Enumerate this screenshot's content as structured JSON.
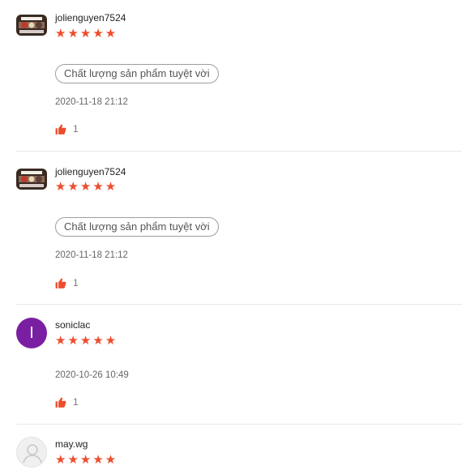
{
  "reviews": [
    {
      "username": "jolienguyen7524",
      "stars": "★★★★★",
      "tag": "Chất lượng sản phẩm tuyệt vời",
      "date": "2020-11-18 21:12",
      "likes": "1",
      "avatar": "product-photo"
    },
    {
      "username": "jolienguyen7524",
      "stars": "★★★★★",
      "tag": "Chất lượng sản phẩm tuyệt vời",
      "date": "2020-11-18 21:12",
      "likes": "1",
      "avatar": "product-photo"
    },
    {
      "username": "soniclac",
      "stars": "★★★★★",
      "avatar_letter": "I",
      "date": "2020-10-26 10:49",
      "likes": "1"
    },
    {
      "username": "may.wg",
      "stars": "★★★★★",
      "avatar": "default-user-icon"
    }
  ],
  "colors": {
    "star": "#ee4d2d",
    "like": "#ee4d2d",
    "avatar_letter_bg": "#7b1fa2"
  }
}
